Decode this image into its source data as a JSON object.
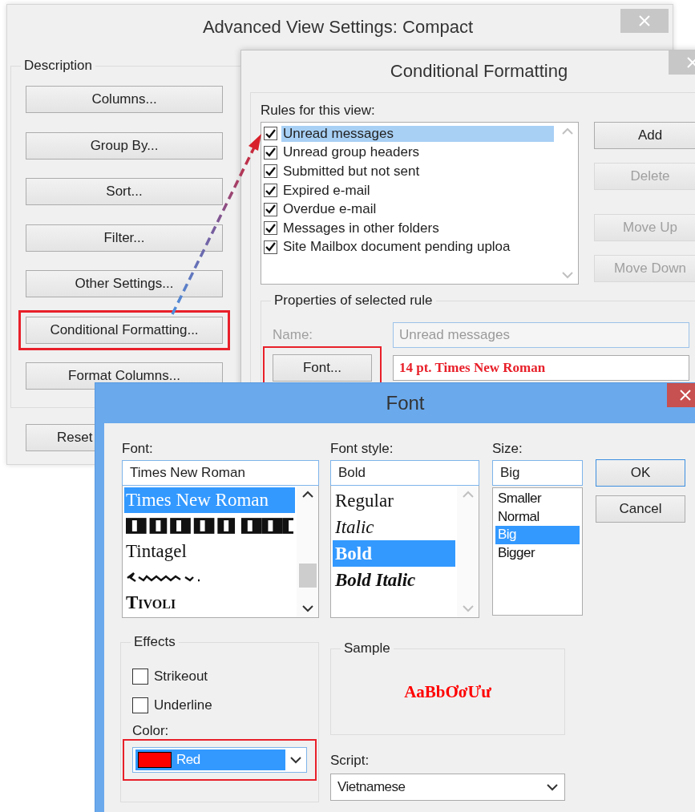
{
  "advanced_dialog": {
    "title": "Advanced View Settings: Compact",
    "group_label": "Description",
    "buttons": [
      {
        "label": "Columns...",
        "highlighted": false
      },
      {
        "label": "Group By...",
        "highlighted": false
      },
      {
        "label": "Sort...",
        "highlighted": false
      },
      {
        "label": "Filter...",
        "highlighted": false
      },
      {
        "label": "Other Settings...",
        "highlighted": false
      },
      {
        "label": "Conditional Formatting...",
        "highlighted": true
      },
      {
        "label": "Format Columns...",
        "highlighted": false
      }
    ],
    "reset_button": "Reset"
  },
  "conditional_dialog": {
    "title": "Conditional Formatting",
    "rules_label": "Rules for this view:",
    "rules": [
      {
        "label": "Unread messages",
        "checked": true,
        "selected": true
      },
      {
        "label": "Unread group headers",
        "checked": true,
        "selected": false
      },
      {
        "label": "Submitted but not sent",
        "checked": true,
        "selected": false
      },
      {
        "label": "Expired e-mail",
        "checked": true,
        "selected": false
      },
      {
        "label": "Overdue e-mail",
        "checked": true,
        "selected": false
      },
      {
        "label": "Messages in other folders",
        "checked": true,
        "selected": false
      },
      {
        "label": "Site Mailbox document pending uploa",
        "checked": true,
        "selected": false
      }
    ],
    "buttons": [
      {
        "label": "Add",
        "disabled": false
      },
      {
        "label": "Delete",
        "disabled": true
      },
      {
        "label": "Move Up",
        "disabled": true
      },
      {
        "label": "Move Down",
        "disabled": true
      }
    ],
    "properties_label": "Properties of selected rule",
    "name_label": "Name:",
    "name_value": "Unread messages",
    "name_disabled": true,
    "font_button": {
      "label": "Font...",
      "highlighted": true
    },
    "font_description": "14 pt. Times New Roman"
  },
  "font_dialog": {
    "title": "Font",
    "font_label": "Font:",
    "font_value": "Times New Roman",
    "fonts": [
      {
        "kind": "text",
        "label": "Times New Roman",
        "selected": true
      },
      {
        "kind": "stencil-preview",
        "selected": false
      },
      {
        "kind": "text",
        "label": "Tintagel",
        "selected": false
      },
      {
        "kind": "squiggle-preview",
        "selected": false
      },
      {
        "kind": "text",
        "label": "Tivoli",
        "selected": false
      }
    ],
    "style_label": "Font style:",
    "style_value": "Bold",
    "styles": [
      {
        "kind": "regular",
        "label": "Regular",
        "selected": false
      },
      {
        "kind": "italic",
        "label": "Italic",
        "selected": false
      },
      {
        "kind": "bold",
        "label": "Bold",
        "selected": true
      },
      {
        "kind": "bold-italic",
        "label": "Bold Italic",
        "selected": false
      }
    ],
    "size_label": "Size:",
    "size_value": "Big",
    "sizes": [
      {
        "label": "Smaller",
        "selected": false
      },
      {
        "label": "Normal",
        "selected": false
      },
      {
        "label": "Big",
        "selected": true
      },
      {
        "label": "Bigger",
        "selected": false
      }
    ],
    "ok_button": "OK",
    "cancel_button": "Cancel",
    "effects_label": "Effects",
    "strikeout": {
      "label": "Strikeout",
      "checked": false
    },
    "underline": {
      "label": "Underline",
      "checked": false
    },
    "color_label": "Color:",
    "color": {
      "label": "Red",
      "color": "#ff0000",
      "highlighted": true
    },
    "sample_label": "Sample",
    "sample_text": "AaBbƠơƯư",
    "script_label": "Script:",
    "script_value": "Vietnamese"
  }
}
